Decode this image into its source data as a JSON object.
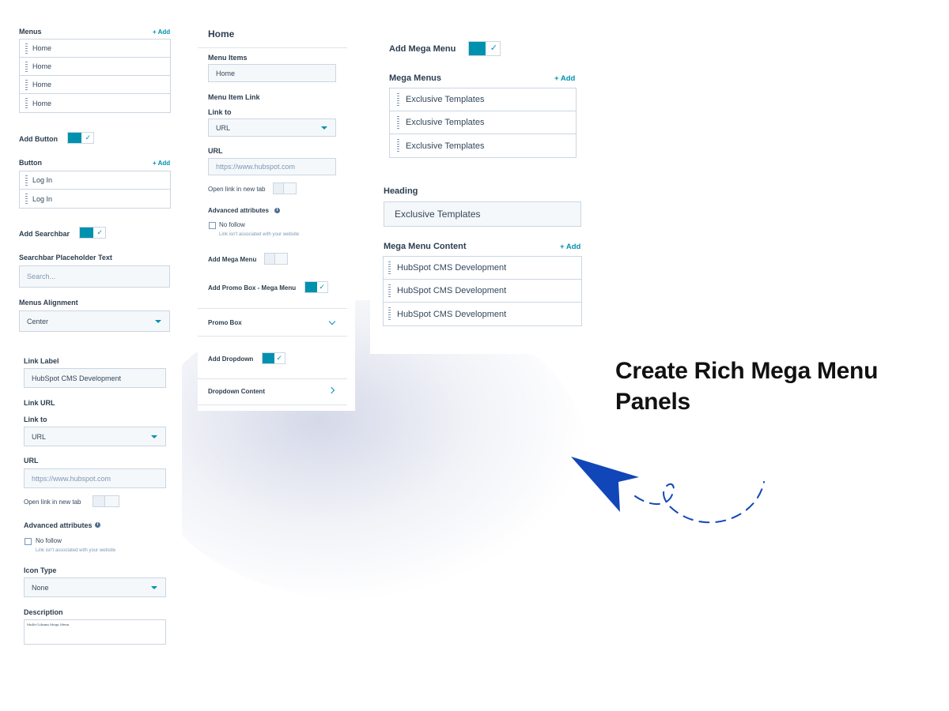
{
  "headline": {
    "line1": "Create Rich Mega Menu",
    "line2": "Panels"
  },
  "left_panel": {
    "menus_label": "Menus",
    "add_label": "+ Add",
    "menu_items": [
      "Home",
      "Home",
      "Home",
      "Home"
    ],
    "add_button_label": "Add Button",
    "button_label": "Button",
    "button_add_label": "+ Add",
    "button_items": [
      "Log In",
      "Log In"
    ],
    "add_searchbar_label": "Add Searchbar",
    "searchbar_placeholder_label": "Searchbar Placeholder Text",
    "searchbar_placeholder_value": "Search...",
    "menus_alignment_label": "Menus Alignment",
    "menus_alignment_value": "Center"
  },
  "bottom_left_panel": {
    "link_label_label": "Link Label",
    "link_label_value": "HubSpot CMS Development",
    "link_url_label": "Link URL",
    "link_to_label": "Link to",
    "link_to_value": "URL",
    "url_label": "URL",
    "url_value": "https://www.hubspot.com",
    "open_new_tab_label": "Open link in new tab",
    "advanced_attributes_label": "Advanced attributes",
    "info_glyph": "i",
    "no_follow_label": "No follow",
    "no_follow_hint": "Link isn't associated with your website",
    "icon_type_label": "Icon Type",
    "icon_type_value": "None",
    "description_label": "Description",
    "description_value": "Multi-Column Mega Menu"
  },
  "middle_panel": {
    "title": "Home",
    "menu_items_label": "Menu Items",
    "menu_items_value": "Home",
    "menu_item_link_label": "Menu Item Link",
    "link_to_label": "Link to",
    "link_to_value": "URL",
    "url_label": "URL",
    "url_value": "https://www.hubspot.com",
    "open_new_tab_label": "Open link in new tab",
    "advanced_attributes_label": "Advanced attributes",
    "info_glyph": "i",
    "no_follow_label": "No follow",
    "no_follow_hint": "Link isn't associated with your website",
    "add_mega_menu_label": "Add Mega Menu",
    "add_promo_box_label": "Add Promo Box - Mega Menu",
    "promo_box_label": "Promo Box",
    "add_dropdown_label": "Add Dropdown",
    "dropdown_content_label": "Dropdown Content"
  },
  "right_top_panel": {
    "add_mega_menu_label": "Add Mega Menu",
    "mega_menus_label": "Mega Menus",
    "add_label": "+ Add",
    "mega_menu_items": [
      "Exclusive Templates",
      "Exclusive Templates",
      "Exclusive Templates"
    ]
  },
  "right_bottom_panel": {
    "heading_label": "Heading",
    "heading_value": "Exclusive Templates",
    "mega_menu_content_label": "Mega Menu Content",
    "add_label": "+ Add",
    "content_items": [
      "HubSpot CMS Development",
      "HubSpot CMS Development",
      "HubSpot CMS Development"
    ]
  },
  "toggles": {
    "check_glyph": "✓"
  },
  "colors": {
    "accent": "#0091ae",
    "arrow": "#1146b8",
    "text": "#33475b",
    "border": "#cbd6e2"
  }
}
